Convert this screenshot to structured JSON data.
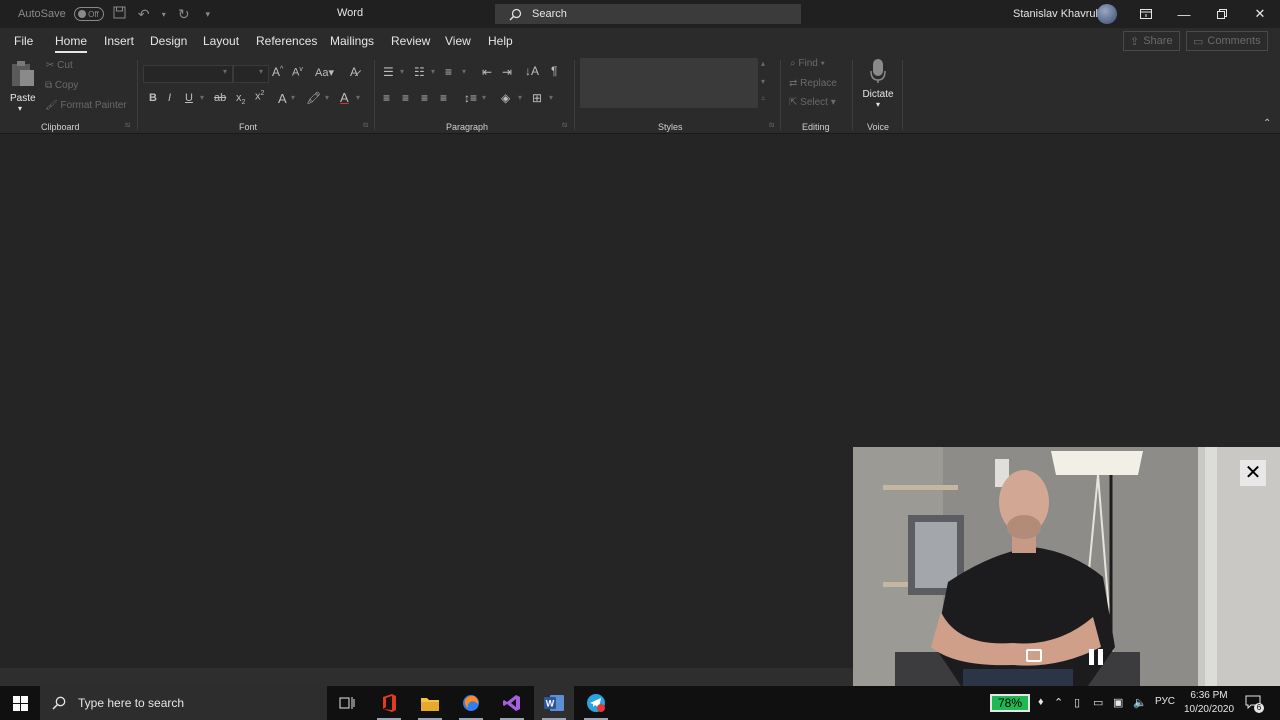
{
  "titlebar": {
    "autosave_label": "AutoSave",
    "autosave_state": "Off",
    "app_name": "Word",
    "search_label": "Search",
    "user_name": "Stanislav Khavruk"
  },
  "tabs": [
    "File",
    "Home",
    "Insert",
    "Design",
    "Layout",
    "References",
    "Mailings",
    "Review",
    "View",
    "Help"
  ],
  "active_tab": "Home",
  "share": {
    "share_label": "Share",
    "comments_label": "Comments"
  },
  "ribbon": {
    "clipboard": {
      "paste": "Paste",
      "cut": "Cut",
      "copy": "Copy",
      "format_painter": "Format Painter",
      "label": "Clipboard"
    },
    "font": {
      "label": "Font"
    },
    "paragraph": {
      "label": "Paragraph"
    },
    "styles": {
      "label": "Styles"
    },
    "editing": {
      "find": "Find",
      "replace": "Replace",
      "select": "Select",
      "label": "Editing"
    },
    "voice": {
      "dictate": "Dictate",
      "label": "Voice"
    }
  },
  "taskbar": {
    "search_placeholder": "Type here to search",
    "battery": "78%",
    "language": "РУС",
    "time": "6:36 PM",
    "date": "10/20/2020",
    "notification_count": "6"
  },
  "colors": {
    "titlebar": "#202020",
    "ribbon": "#2b2b2b",
    "document": "#252525",
    "taskbar": "#101010",
    "battery": "#1db954",
    "word_blue": "#2b579a"
  }
}
